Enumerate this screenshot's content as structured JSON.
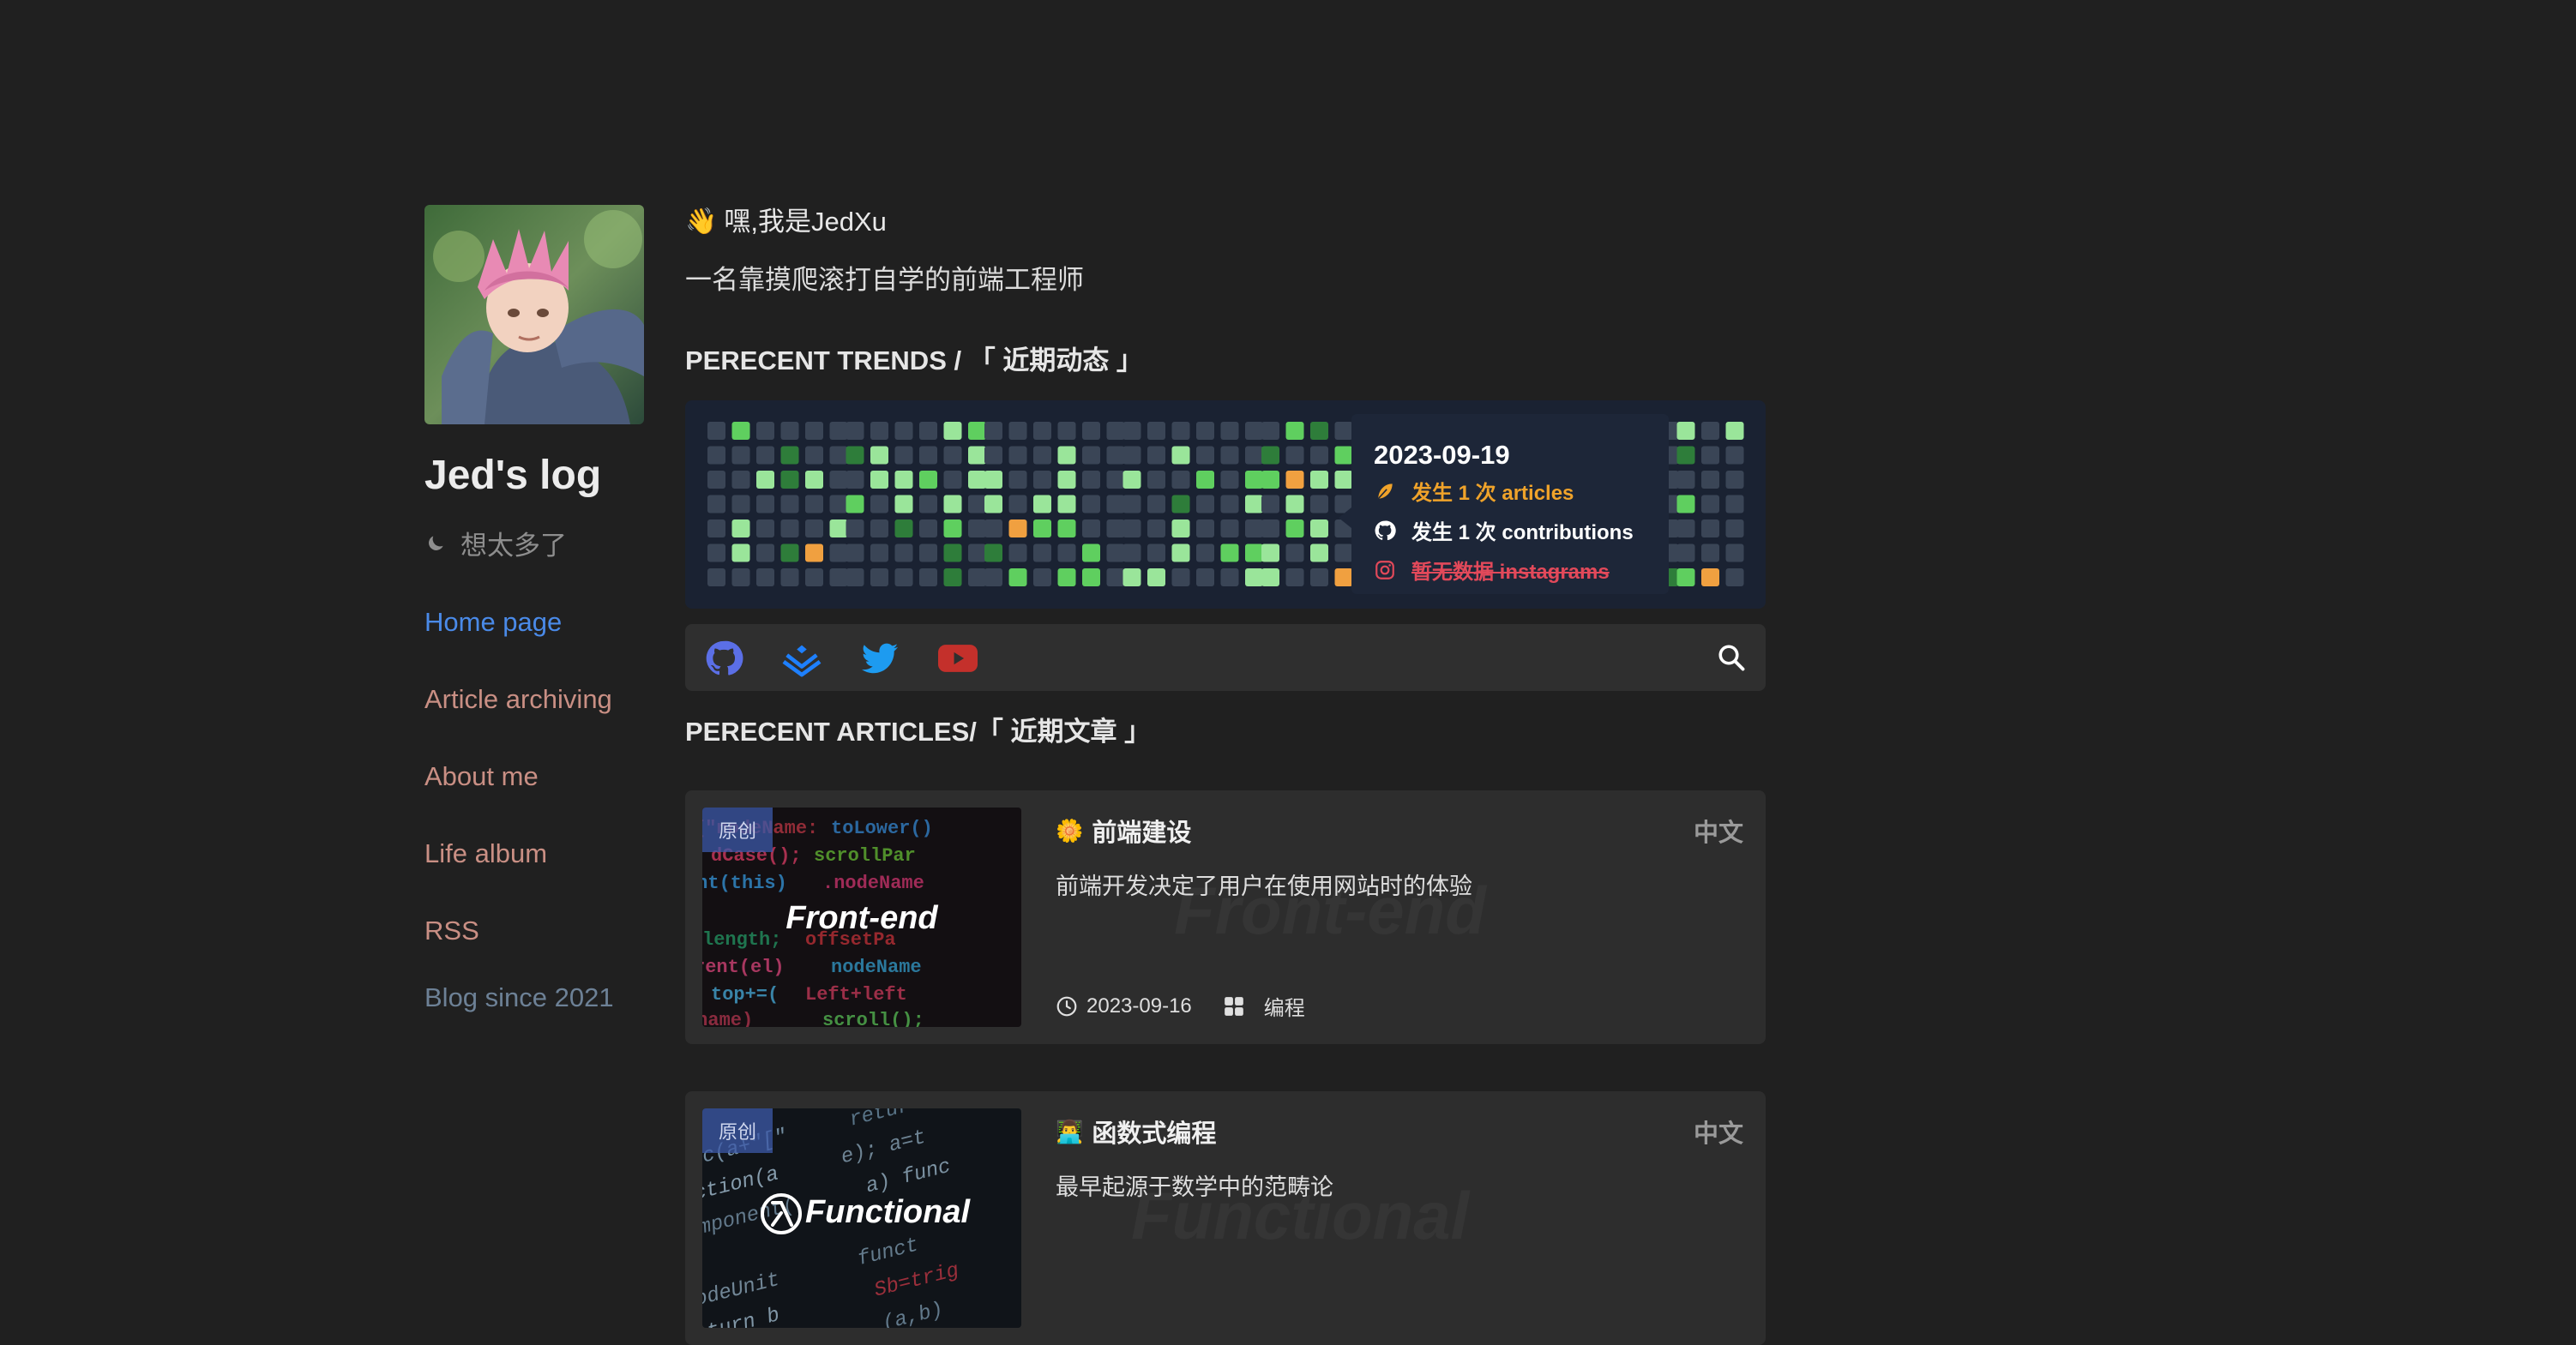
{
  "sidebar": {
    "avatar_alt": "avatar",
    "site_title": "Jed's log",
    "motto": "想太多了",
    "nav": [
      {
        "label": "Home page",
        "active": true
      },
      {
        "label": "Article archiving",
        "active": false
      },
      {
        "label": "About me",
        "active": false
      },
      {
        "label": "Life album",
        "active": false
      },
      {
        "label": "RSS",
        "active": false
      }
    ],
    "since": "Blog since 2021"
  },
  "main": {
    "greeting": "嘿,我是JedXu",
    "greeting_emoji": "👋",
    "intro": "一名靠摸爬滚打自学的前端工程师",
    "trends_title": "PERECENT TRENDS / 「 近期动态 」",
    "articles_title": "PERECENT ARTICLES/「 近期文章 」"
  },
  "heatmap": {
    "level_colors": [
      "#3a4556",
      "#9ae59a",
      "#5fcf5f",
      "#2e7d3a",
      "#f0a040"
    ],
    "tooltip": {
      "date": "2023-09-19",
      "articles": "发生 1 次 articles",
      "contributions": "发生 1 次 contributions",
      "instagrams": "暂无数据 instagrams"
    }
  },
  "social": {
    "items": [
      "github-icon",
      "juejin-icon",
      "twitter-icon",
      "youtube-icon"
    ],
    "colors": {
      "github": "#5b6fe6",
      "juejin": "#1e80ff",
      "twitter": "#1d9bf0",
      "youtube": "#c4302b"
    }
  },
  "articles": [
    {
      "badge": "原创",
      "thumb_title": "Front-end",
      "title_emoji": "🌼",
      "title": "前端建设",
      "lang": "中文",
      "desc": "前端开发决定了用户在使用网站时的体验",
      "date": "2023-09-16",
      "category": "编程"
    },
    {
      "badge": "原创",
      "thumb_title": "Functional",
      "title_emoji": "👨‍💻",
      "title": "函数式编程",
      "lang": "中文",
      "desc": "最早起源于数学中的范畴论"
    }
  ]
}
